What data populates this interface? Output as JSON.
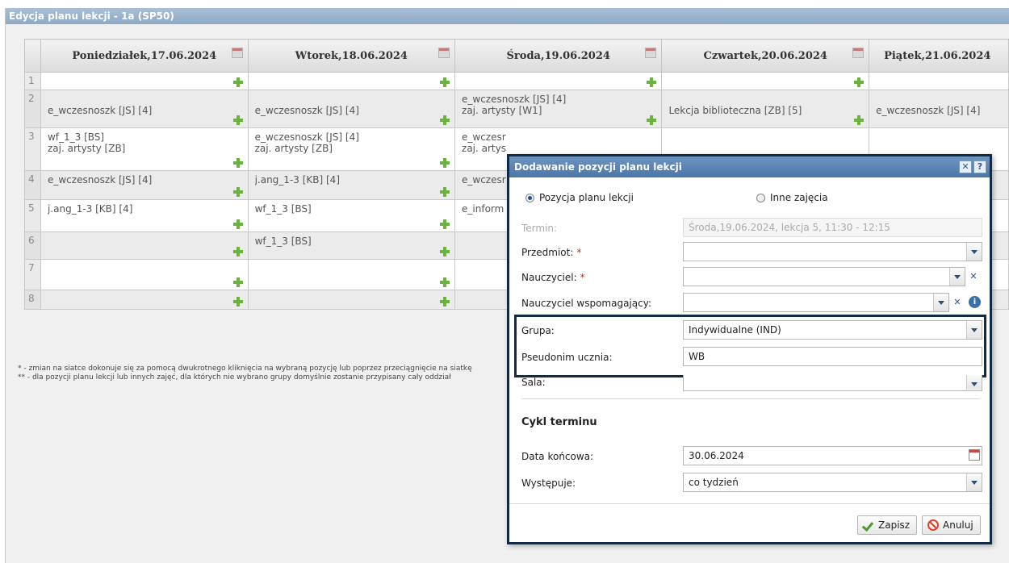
{
  "panel": {
    "title": "Edycja planu lekcji - 1a (SP50)"
  },
  "schedule": {
    "days": [
      "Poniedziałek,17.06.2024",
      "Wtorek,18.06.2024",
      "Środa,19.06.2024",
      "Czwartek,20.06.2024",
      "Piątek,21.06.2024"
    ],
    "rows": [
      {
        "num": "1",
        "cells": [
          [],
          [],
          [],
          [],
          []
        ]
      },
      {
        "num": "2",
        "cells": [
          [
            "e_wczesnoszk [JS] [4]"
          ],
          [
            "e_wczesnoszk [JS] [4]"
          ],
          [
            "e_wczesnoszk [JS] [4]",
            "zaj. artysty [W1]"
          ],
          [
            "Lekcja biblioteczna [ZB] [5]"
          ],
          [
            "e_wczesnoszk [JS] [4]"
          ]
        ]
      },
      {
        "num": "3",
        "cells": [
          [
            "wf_1_3 [BS]",
            "zaj. artysty [ZB]"
          ],
          [
            "e_wczesnoszk [JS] [4]",
            "zaj. artysty [ZB]"
          ],
          [
            "e_wczesr",
            "zaj. artys"
          ],
          [],
          []
        ]
      },
      {
        "num": "4",
        "cells": [
          [
            "e_wczesnoszk [JS] [4]"
          ],
          [
            "j.ang_1-3 [KB] [4]"
          ],
          [
            "e_wczesr"
          ],
          [],
          []
        ]
      },
      {
        "num": "5",
        "cells": [
          [
            "j.ang_1-3 [KB] [4]"
          ],
          [
            "wf_1_3 [BS]"
          ],
          [
            "e_inform"
          ],
          [],
          []
        ]
      },
      {
        "num": "6",
        "cells": [
          [],
          [
            "wf_1_3 [BS]"
          ],
          [],
          [],
          []
        ]
      },
      {
        "num": "7",
        "cells": [
          [],
          [],
          [],
          [],
          []
        ]
      },
      {
        "num": "8",
        "cells": [
          [],
          [],
          [],
          [],
          []
        ]
      }
    ]
  },
  "footnotes": [
    "* - zmian na siatce dokonuje się za pomocą dwukrotnego kliknięcia na wybraną pozycję lub poprzez przeciągnięcie na siatkę",
    "** - dla pozycji planu lekcji lub innych zajęć, dla których nie wybrano grupy domyślnie zostanie przypisany cały oddział"
  ],
  "dialog": {
    "title": "Dodawanie pozycji planu lekcji",
    "close_glyph": "✕",
    "help_glyph": "?",
    "radio_lesson": "Pozycja planu lekcji",
    "radio_other": "Inne zajęcia",
    "termin_label": "Termin:",
    "termin_value": "Środa,19.06.2024, lekcja 5, 11:30 - 12:15",
    "przedmiot_label": "Przedmiot:",
    "nauczyciel_label": "Nauczyciel:",
    "nauczyciel_wsp_label": "Nauczyciel wspomagający:",
    "grupa_label": "Grupa:",
    "grupa_value": "Indywidualne (IND)",
    "pseudonim_label": "Pseudonim ucznia:",
    "pseudonim_value": "WB",
    "sala_label": "Sala:",
    "required_mark": "*",
    "clear_glyph": "✕",
    "info_glyph": "i",
    "cycle_title": "Cykl terminu",
    "data_koncowa_label": "Data końcowa:",
    "data_koncowa_value": "30.06.2024",
    "wystepuje_label": "Występuje:",
    "wystepuje_value": "co tydzień",
    "save_label": "Zapisz",
    "cancel_label": "Anuluj"
  },
  "colors": {
    "accent": "#4a76a8",
    "highlight_border": "#132a45",
    "plus_green": "#6bb33d"
  }
}
